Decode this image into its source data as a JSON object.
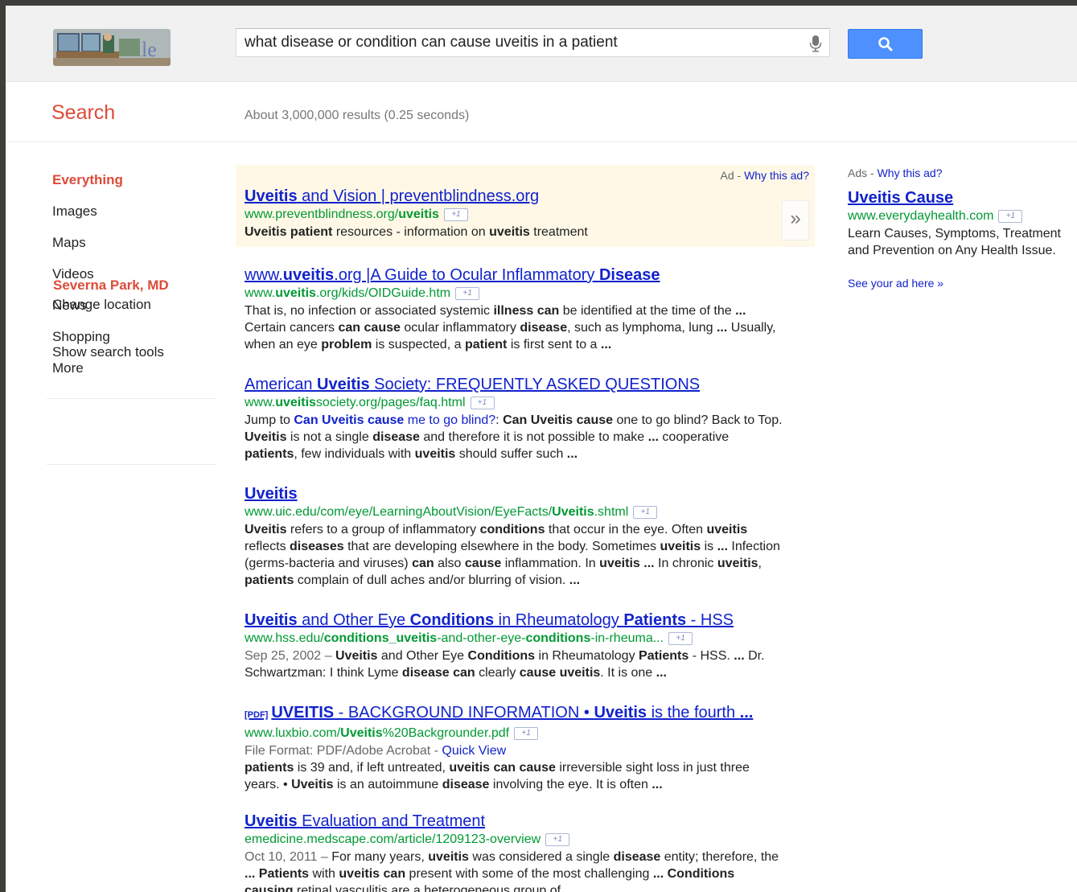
{
  "header": {
    "query": "what disease or condition can cause uveitis in a patient",
    "search_button_icon": "search-icon",
    "mic_icon": "microphone-icon"
  },
  "subheader": {
    "title": "Search",
    "stats": "About 3,000,000 results (0.25 seconds)"
  },
  "leftnav": {
    "items": [
      "Everything",
      "Images",
      "Maps",
      "Videos",
      "News",
      "Shopping",
      "More"
    ],
    "location": "Severna Park, MD",
    "change_location": "Change location",
    "tools": "Show search tools"
  },
  "top_ad": {
    "label": "Ad - ",
    "why": "Why this ad?",
    "title": "Uveitis and Vision | preventblindness.org",
    "url": "www.preventblindness.org/uveitis",
    "snippet": "Uveitis patient resources - information on uveitis treatment",
    "arrow": "»"
  },
  "plus_one": "+1",
  "results": [
    {
      "title": "www.uveitis.org |A Guide to Ocular Inflammatory Disease",
      "url": "www.uveitis.org/kids/OIDGuide.htm",
      "snippet": "That is, no infection or associated systemic illness can be identified at the time of the ... Certain cancers can cause ocular inflammatory disease, such as lymphoma, lung ... Usually, when an eye problem is suspected, a patient is first sent to a ..."
    },
    {
      "title": "American Uveitis Society: FREQUENTLY ASKED QUESTIONS",
      "url": "www.uveitissociety.org/pages/faq.html",
      "jump_prefix": "Jump to ",
      "jump_link": "Can Uveitis cause me to go blind?",
      "snippet": "Can Uveitis cause one to go blind? Back to Top. Uveitis is not a single disease and therefore it is not possible to make ... cooperative patients, few individuals with uveitis should suffer such ..."
    },
    {
      "title": "Uveitis",
      "url": "www.uic.edu/com/eye/LearningAboutVision/EyeFacts/Uveitis.shtml",
      "snippet": "Uveitis refers to a group of inflammatory conditions that occur in the eye. Often uveitis reflects diseases that are developing elsewhere in the body. Sometimes uveitis is ... Infection (germs-bacteria and viruses) can also cause inflammation. In uveitis ... In chronic uveitis, patients complain of dull aches and/or blurring of vision. ..."
    },
    {
      "title": "Uveitis and Other Eye Conditions in Rheumatology Patients - HSS",
      "url": "www.hss.edu/conditions_uveitis-and-other-eye-conditions-in-rheuma...",
      "date": "Sep 25, 2002 – ",
      "snippet": "Uveitis and Other Eye Conditions in Rheumatology Patients - HSS. ... Dr. Schwartzman: I think Lyme disease can clearly cause uveitis. It is one ..."
    },
    {
      "pdf_tag": "[PDF]",
      "title": "UVEITIS - BACKGROUND INFORMATION • Uveitis is the fourth ...",
      "url": "www.luxbio.com/Uveitis%20Backgrounder.pdf",
      "format_label": "File Format: PDF/Adobe Acrobat - ",
      "quick_view": "Quick View",
      "snippet": "patients is 39 and, if left untreated, uveitis can cause irreversible sight loss in just three years. • Uveitis is an autoimmune disease involving the eye. It is often ..."
    },
    {
      "title": "Uveitis Evaluation and Treatment",
      "url": "emedicine.medscape.com/article/1209123-overview",
      "date": "Oct 10, 2011 – ",
      "snippet": "For many years, uveitis was considered a single disease entity; therefore, the ... Patients with uveitis can present with some of the most challenging ... Conditions causing retinal vasculitis are a heterogeneous group of ..."
    }
  ],
  "rhs": {
    "label": "Ads - ",
    "why": "Why this ad?",
    "title": "Uveitis Cause",
    "url": "www.everydayhealth.com",
    "line1": "Learn Causes, Symptoms, Treatment",
    "line2": "and Prevention on Any Health Issue.",
    "see_ad": "See your ad here »"
  }
}
